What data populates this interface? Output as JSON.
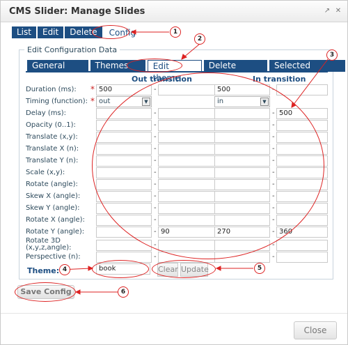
{
  "dialog": {
    "title": "CMS Slider: Manage Slides",
    "icons": [
      "popout-icon",
      "close-icon"
    ]
  },
  "topnav": [
    {
      "label": "List"
    },
    {
      "label": "Edit"
    },
    {
      "label": "Delete"
    },
    {
      "label": "Config"
    }
  ],
  "panel": {
    "legend": "Edit Configuration Data"
  },
  "tabs": [
    {
      "label": "General data"
    },
    {
      "label": "Themes list"
    },
    {
      "label": "Edit theme"
    },
    {
      "label": "Delete theme"
    },
    {
      "label": "Selected themes"
    }
  ],
  "columns": {
    "out": "Out transition",
    "in": "In transition"
  },
  "rows": [
    {
      "label": "Duration (ms):",
      "required": "*",
      "out_a": "500",
      "out_b": "",
      "in_a": "500",
      "in_b": ""
    },
    {
      "label": "Timing (function):",
      "required": "*",
      "out_a": "out",
      "in_a": "in"
    },
    {
      "label": "Delay (ms):",
      "out_a": "",
      "out_b": "",
      "in_a": "",
      "in_b": "500"
    },
    {
      "label": "Opacity (0..1):",
      "out_a": "",
      "out_b": "",
      "in_a": "",
      "in_b": ""
    },
    {
      "label": "Translate (x,y):",
      "out_a": "",
      "out_b": "",
      "in_a": "",
      "in_b": ""
    },
    {
      "label": "Translate X (n):",
      "out_a": "",
      "out_b": "",
      "in_a": "",
      "in_b": ""
    },
    {
      "label": "Translate Y (n):",
      "out_a": "",
      "out_b": "",
      "in_a": "",
      "in_b": ""
    },
    {
      "label": "Scale (x,y):",
      "out_a": "",
      "out_b": "",
      "in_a": "",
      "in_b": ""
    },
    {
      "label": "Rotate (angle):",
      "out_a": "",
      "out_b": "",
      "in_a": "",
      "in_b": ""
    },
    {
      "label": "Skew X (angle):",
      "out_a": "",
      "out_b": "",
      "in_a": "",
      "in_b": ""
    },
    {
      "label": "Skew Y (angle):",
      "out_a": "",
      "out_b": "",
      "in_a": "",
      "in_b": ""
    },
    {
      "label": "Rotate X (angle):",
      "out_a": "",
      "out_b": "",
      "in_a": "",
      "in_b": ""
    },
    {
      "label": "Rotate Y (angle):",
      "out_a": "",
      "out_b": "90",
      "in_a": "270",
      "in_b": "360"
    },
    {
      "label": "Rotate 3D (x,y,z,angle):",
      "out_a": "",
      "out_b": "",
      "in_a": "",
      "in_b": ""
    },
    {
      "label": "Perspective (n):",
      "out_a": "",
      "out_b": "",
      "in_a": "",
      "in_b": ""
    }
  ],
  "separator": "-",
  "theme": {
    "label": "Theme:",
    "value": "book",
    "clear_label": "Clear",
    "update_label": "Update"
  },
  "save_label": "Save Config",
  "close_label": "Close",
  "annotations": [
    "1",
    "2",
    "3",
    "4",
    "5",
    "6"
  ],
  "colors": {
    "nav_blue": "#1d4e82",
    "annotation_red": "#dd2222",
    "required_red": "#cc2222"
  }
}
